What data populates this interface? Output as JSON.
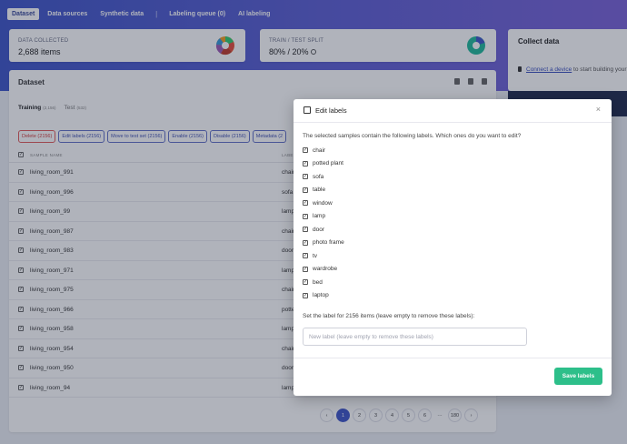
{
  "nav": {
    "tabs": [
      "Dataset",
      "Data sources",
      "Synthetic data"
    ],
    "tabs2": [
      "Labeling queue (0)",
      "AI labeling"
    ]
  },
  "stats": {
    "collected_label": "DATA COLLECTED",
    "collected_value": "2,688 items",
    "split_label": "TRAIN / TEST SPLIT",
    "split_value": "80% / 20%"
  },
  "collect": {
    "title": "Collect data",
    "link": "Connect a device",
    "text": " to start building your"
  },
  "dataset": {
    "title": "Dataset",
    "training_label": "Training",
    "training_count": "(2,156)",
    "test_label": "Test",
    "test_count": "(532)",
    "actions": [
      "Delete (2156)",
      "Edit labels (2156)",
      "Move to test set (2156)",
      "Enable (2156)",
      "Disable (2156)",
      "Metadata (2"
    ],
    "col_name": "SAMPLE NAME",
    "col_label": "LABEL",
    "rows": [
      {
        "name": "living_room_991",
        "label": "chair"
      },
      {
        "name": "living_room_996",
        "label": "sofa"
      },
      {
        "name": "living_room_99",
        "label": "lamp"
      },
      {
        "name": "living_room_987",
        "label": "chair"
      },
      {
        "name": "living_room_983",
        "label": "door"
      },
      {
        "name": "living_room_971",
        "label": "lamp"
      },
      {
        "name": "living_room_975",
        "label": "chair"
      },
      {
        "name": "living_room_966",
        "label": "potted"
      },
      {
        "name": "living_room_958",
        "label": "lamp"
      },
      {
        "name": "living_room_954",
        "label": "chair"
      },
      {
        "name": "living_room_950",
        "label": "door"
      },
      {
        "name": "living_room_94",
        "label": "lamp"
      }
    ],
    "pages": [
      "1",
      "2",
      "3",
      "4",
      "5",
      "6",
      "···",
      "180"
    ]
  },
  "modal": {
    "title": "Edit labels",
    "close": "×",
    "question": "The selected samples contain the following labels. Which ones do you want to edit?",
    "labels": [
      "chair",
      "potted plant",
      "sofa",
      "table",
      "window",
      "lamp",
      "door",
      "photo frame",
      "tv",
      "wardrobe",
      "bed",
      "laptop"
    ],
    "set_text": "Set the label for 2156 items (leave empty to remove these labels):",
    "input_placeholder": "New label (leave empty to remove these labels)",
    "save": "Save labels"
  }
}
